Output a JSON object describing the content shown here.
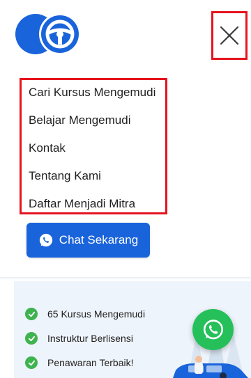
{
  "brand": {
    "logo_icon": "steering-wheel-icon",
    "primary_color": "#1a64db"
  },
  "header": {
    "close_icon": "close-icon"
  },
  "menu": {
    "items": [
      {
        "label": "Cari Kursus Mengemudi"
      },
      {
        "label": "Belajar Mengemudi"
      },
      {
        "label": "Kontak"
      },
      {
        "label": "Tentang Kami"
      },
      {
        "label": "Daftar Menjadi Mitra"
      }
    ]
  },
  "cta": {
    "label": "Chat Sekarang",
    "icon": "whatsapp-icon"
  },
  "features": [
    {
      "label": "65 Kursus Mengemudi"
    },
    {
      "label": "Instruktur Berlisensi"
    },
    {
      "label": "Penawaran Terbaik!"
    }
  ],
  "floating": {
    "icon": "whatsapp-icon",
    "color": "#25c05a"
  },
  "accent_colors": {
    "highlight_border": "#e5141e",
    "check": "#3fb34f"
  }
}
